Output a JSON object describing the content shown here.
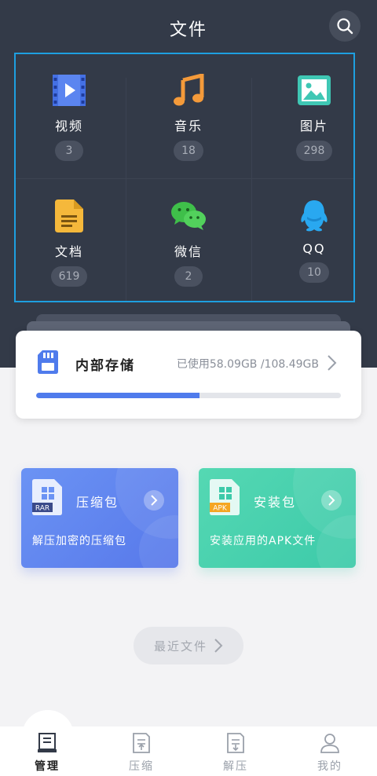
{
  "header": {
    "title": "文件"
  },
  "categories": [
    {
      "label": "视频",
      "count": "3"
    },
    {
      "label": "音乐",
      "count": "18"
    },
    {
      "label": "图片",
      "count": "298"
    },
    {
      "label": "文档",
      "count": "619"
    },
    {
      "label": "微信",
      "count": "2"
    },
    {
      "label": "QQ",
      "count": "10"
    }
  ],
  "storage": {
    "title": "内部存储",
    "usage": "已使用58.09GB /108.49GB",
    "used_fraction": 0.536
  },
  "cards": {
    "rar": {
      "badge": "RAR",
      "title": "压缩包",
      "desc": "解压加密的压缩包"
    },
    "apk": {
      "badge": "APK",
      "title": "安装包",
      "desc": "安装应用的APK文件"
    }
  },
  "recent": {
    "label": "最近文件"
  },
  "tabs": [
    {
      "label": "管理"
    },
    {
      "label": "压缩"
    },
    {
      "label": "解压"
    },
    {
      "label": "我的"
    }
  ],
  "colors": {
    "header_bg": "#333a48",
    "accent_blue": "#4f7bec",
    "grid_border": "#1e9fe0",
    "apk_green": "#3ccaa9",
    "rar_blue": "#5778ea"
  }
}
